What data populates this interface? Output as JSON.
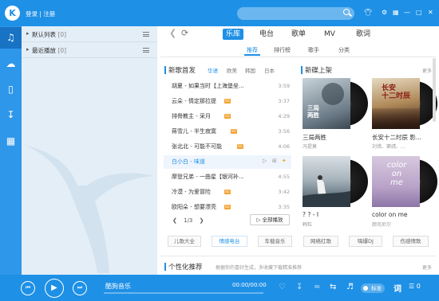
{
  "titlebar": {
    "logo_letter": "K",
    "login_text": "登录 | 注册",
    "icons": [
      "shirt-icon",
      "gear-icon",
      "mini-mode-icon",
      "minimize-icon",
      "maximize-icon",
      "close-icon"
    ]
  },
  "rail": {
    "items": [
      "music-note-icon",
      "cloud-icon",
      "phone-icon",
      "download-icon",
      "apps-icon"
    ]
  },
  "playlists": [
    {
      "name": "默认列表",
      "count": "[0]"
    },
    {
      "name": "最近播放",
      "count": "[0]"
    }
  ],
  "main_tabs": [
    "乐库",
    "电台",
    "歌单",
    "MV",
    "歌词"
  ],
  "sub_tabs": [
    "推荐",
    "排行榜",
    "歌手",
    "分类"
  ],
  "new_songs": {
    "title": "新歌首发",
    "categories": [
      "华语",
      "欧美",
      "韩国",
      "日本"
    ],
    "songs": [
      {
        "title": "胡夏 - 如果当时【上海堡垒...",
        "duration": "3:59"
      },
      {
        "title": "云朵 - 情定那拉提",
        "duration": "3:37"
      },
      {
        "title": "排骨教主 - 采月",
        "duration": "4:29"
      },
      {
        "title": "蒋雪儿 - 半生寂寞",
        "duration": "3:56"
      },
      {
        "title": "张北北 - 可能不可能",
        "duration": "4:06"
      },
      {
        "title": "白小白 - 味道",
        "duration": ""
      },
      {
        "title": "摩登兄弟 - 一曲星【银河补...",
        "duration": "4:55"
      },
      {
        "title": "冷漠 - 为爱冒险",
        "duration": "3:42"
      },
      {
        "title": "欧阳朵 - 想要漂亮",
        "duration": "3:35"
      }
    ],
    "page": "1/3",
    "play_all": "全部播放"
  },
  "new_albums": {
    "title": "新碟上架",
    "more": "更多",
    "albums": [
      {
        "title": "三局两胜",
        "artist": "冯提莫",
        "cover_text": "三局\n两胜"
      },
      {
        "title": "长安十二时辰 影...",
        "artist": "刘惜、窦靖、...",
        "cover_text": "长安\n十二时辰"
      },
      {
        "title": "? ? - I",
        "artist": "韩粒",
        "cover_text": ""
      },
      {
        "title": "color on me",
        "artist": "颜司尼尔",
        "cover_text": "color\non\nme"
      }
    ]
  },
  "tags": [
    "儿歌大全",
    "情感电台",
    "车载音乐",
    "网络红歌",
    "嗨爆DJ",
    "伤感情歌"
  ],
  "personal": {
    "title": "个性化推荐",
    "subtitle": "根据你的喜好生成，多收藏下载精准推荐",
    "more": "更多"
  },
  "player": {
    "title": "酷狗音乐",
    "time": "00:00/00:00",
    "quality": "标准",
    "lyric": "词"
  },
  "colors": {
    "brand": "#1e90e6",
    "badge": "#f3a02f"
  }
}
